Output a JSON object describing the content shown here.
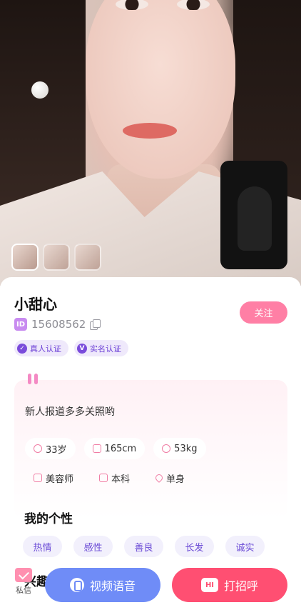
{
  "profile": {
    "name": "小甜心",
    "id_badge": "ID",
    "id_number": "15608562",
    "follow_label": "关注",
    "verify_tags": [
      {
        "icon": "shield-icon",
        "glyph": "✓",
        "label": "真人认证"
      },
      {
        "icon": "v-badge-icon",
        "glyph": "V",
        "label": "实名认证"
      }
    ]
  },
  "intro": {
    "text": "新人报道多多关照哟",
    "details_row1": [
      {
        "icon": "age-icon",
        "label": "33岁"
      },
      {
        "icon": "height-icon",
        "label": "165cm"
      },
      {
        "icon": "weight-icon",
        "label": "53kg"
      }
    ],
    "details_row2": [
      {
        "icon": "job-icon",
        "label": "美容师"
      },
      {
        "icon": "education-icon",
        "label": "本科"
      },
      {
        "icon": "heart-icon",
        "label": "单身"
      }
    ]
  },
  "personality": {
    "title": "我的个性",
    "traits": [
      "热情",
      "感性",
      "善良",
      "长发",
      "诚实"
    ]
  },
  "interests": {
    "title": "兴趣"
  },
  "bottom_bar": {
    "message_label": "私信",
    "video_label": "视频语音",
    "hi_icon_text": "HI",
    "greet_label": "打招呼"
  },
  "colors": {
    "follow": "#ff7fa5",
    "video_button": "#6f8cf7",
    "greet_button": "#ff4f72",
    "trait_text": "#6b4bd6"
  }
}
